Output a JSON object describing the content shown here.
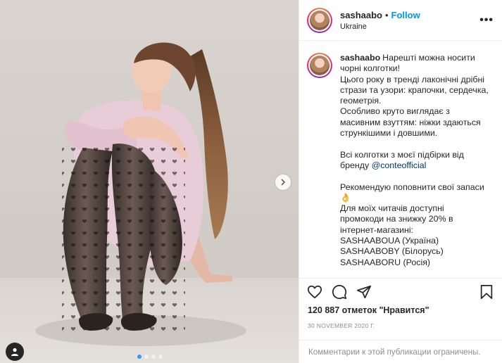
{
  "post": {
    "username": "sashaabo",
    "separator": "•",
    "follow_label": "Follow",
    "location": "Ukraine",
    "more_label": "•••"
  },
  "caption": {
    "username": "sashaabo",
    "lines": [
      "Нарешті можна носити",
      "чорні колготки!",
      "Цього року в тренді лаконічні дрібні",
      "стрази та узори: крапочки, сердечка,",
      "геометрія.",
      "Особливо круто виглядає з",
      "масивним взуттям: ніжки здаються",
      "стрункішими і довшими."
    ],
    "brand_prefix_1": "Всі колготки з моєї підбірки від",
    "brand_prefix_2": "бренду",
    "mention": "@conteofficial",
    "recommend": "Рекомендую поповнити свої запаси",
    "recommend_emoji": "👌",
    "promo_lines": [
      "Для моїх читачів доступні",
      "промокоди на знижку 20% в",
      "інтернет-магазині:",
      "SASHAABOUA (Україна)",
      "SASHAABOBY (Білорусь)",
      "SASHAABORU (Росія)"
    ]
  },
  "stats": {
    "likes_text": "120 887 отметок \"Нравится\"",
    "date": "30 NOVEMBER 2020 г."
  },
  "comments": {
    "limited_text": "Комментарии к этой публикации ограничены."
  },
  "carousel": {
    "total": 4,
    "active_index": 0
  },
  "icons": {
    "like": "heart-icon",
    "comment": "comment-icon",
    "share": "paper-plane-icon",
    "save": "bookmark-icon",
    "next": "chevron-right-icon",
    "tags": "user-tag-icon"
  },
  "colors": {
    "follow": "#0095f6",
    "mention": "#00376b",
    "muted": "#8e8e8e",
    "carousel_active": "#3897f0"
  }
}
